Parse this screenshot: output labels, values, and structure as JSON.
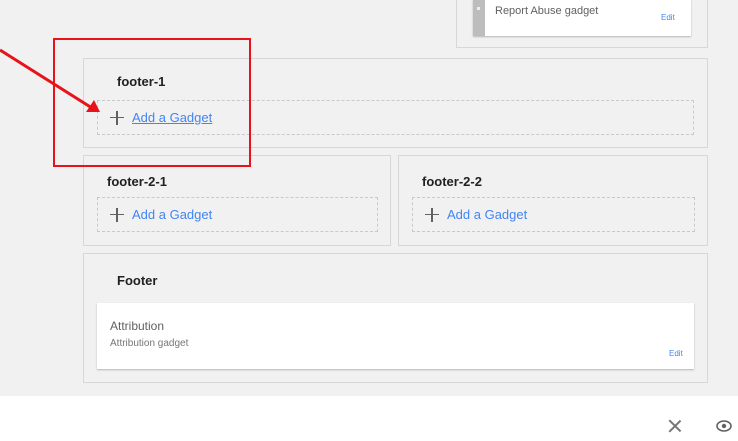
{
  "report_abuse": {
    "title": "Report Abuse gadget",
    "edit": "Edit"
  },
  "footer1": {
    "title": "footer-1",
    "add": "Add a Gadget"
  },
  "footer21": {
    "title": "footer-2-1",
    "add": "Add a Gadget"
  },
  "footer22": {
    "title": "footer-2-2",
    "add": "Add a Gadget"
  },
  "footer": {
    "title": "Footer",
    "gadget": {
      "title": "Attribution",
      "subtitle": "Attribution gadget",
      "edit": "Edit"
    }
  },
  "toolbar": {
    "close_icon": "close-icon",
    "preview_icon": "eye-icon"
  },
  "colors": {
    "accent": "#4285f4",
    "annotation": "#e8121a",
    "canvas": "#f1f1f1"
  }
}
